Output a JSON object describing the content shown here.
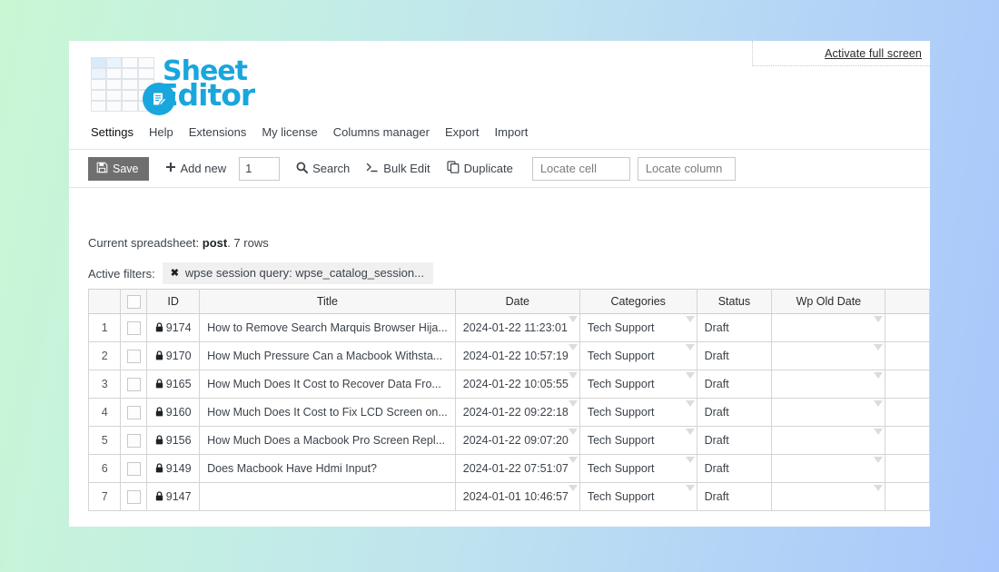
{
  "app": {
    "logo": {
      "word1": "Sheet",
      "word2": "Editor",
      "badge_icon": "notepad-pencil-icon",
      "brand_color": "#19a6dd"
    },
    "fullscreen_link": "Activate full screen"
  },
  "nav": {
    "items": [
      {
        "label": "Settings",
        "active": true
      },
      {
        "label": "Help",
        "active": false
      },
      {
        "label": "Extensions",
        "active": false
      },
      {
        "label": "My license",
        "active": false
      },
      {
        "label": "Columns manager",
        "active": false
      },
      {
        "label": "Export",
        "active": false
      },
      {
        "label": "Import",
        "active": false
      }
    ]
  },
  "toolbar": {
    "save_label": "Save",
    "save_icon": "floppy-disk-icon",
    "save_bg": "#6f6f6f",
    "add_new_label": "Add new",
    "add_new_icon": "plus-icon",
    "rows_value": "1",
    "search_label": "Search",
    "search_icon": "magnifier-icon",
    "bulk_edit_label": "Bulk Edit",
    "bulk_edit_icon": "terminal-prompt-icon",
    "duplicate_label": "Duplicate",
    "duplicate_icon": "copy-icon",
    "locate_cell_placeholder": "Locate cell",
    "locate_column_placeholder": "Locate column"
  },
  "status": {
    "prefix": "Current spreadsheet:",
    "sheet_name": "post",
    "suffix": ". 7 rows",
    "rows_count": 7
  },
  "filters": {
    "label": "Active filters:",
    "chips": [
      {
        "remove_icon": "close-x-icon",
        "label": "wpse session query: wpse_catalog_session..."
      }
    ]
  },
  "sheet": {
    "columns": [
      {
        "key": "rownum",
        "label": ""
      },
      {
        "key": "chk",
        "label": ""
      },
      {
        "key": "id",
        "label": "ID"
      },
      {
        "key": "title",
        "label": "Title"
      },
      {
        "key": "date",
        "label": "Date"
      },
      {
        "key": "cat",
        "label": "Categories"
      },
      {
        "key": "status",
        "label": "Status"
      },
      {
        "key": "wpold",
        "label": "Wp Old Date"
      },
      {
        "key": "extra",
        "label": ""
      }
    ],
    "rows": [
      {
        "n": "1",
        "id": "9174",
        "locked": true,
        "title": "How to Remove Search Marquis Browser Hija...",
        "date": "2024-01-22 11:23:01",
        "cat": "Tech Support",
        "status": "Draft",
        "wpold": ""
      },
      {
        "n": "2",
        "id": "9170",
        "locked": true,
        "title": "How Much Pressure Can a Macbook Withsta...",
        "date": "2024-01-22 10:57:19",
        "cat": "Tech Support",
        "status": "Draft",
        "wpold": ""
      },
      {
        "n": "3",
        "id": "9165",
        "locked": true,
        "title": "How Much Does It Cost to Recover Data Fro...",
        "date": "2024-01-22 10:05:55",
        "cat": "Tech Support",
        "status": "Draft",
        "wpold": ""
      },
      {
        "n": "4",
        "id": "9160",
        "locked": true,
        "title": "How Much Does It Cost to Fix LCD Screen on...",
        "date": "2024-01-22 09:22:18",
        "cat": "Tech Support",
        "status": "Draft",
        "wpold": ""
      },
      {
        "n": "5",
        "id": "9156",
        "locked": true,
        "title": "How Much Does a Macbook Pro Screen Repl...",
        "date": "2024-01-22 09:07:20",
        "cat": "Tech Support",
        "status": "Draft",
        "wpold": ""
      },
      {
        "n": "6",
        "id": "9149",
        "locked": true,
        "title": "Does Macbook Have Hdmi Input?",
        "date": "2024-01-22 07:51:07",
        "cat": "Tech Support",
        "status": "Draft",
        "wpold": ""
      },
      {
        "n": "7",
        "id": "9147",
        "locked": true,
        "title": "",
        "date": "2024-01-01 10:46:57",
        "cat": "Tech Support",
        "status": "Draft",
        "wpold": ""
      }
    ]
  }
}
